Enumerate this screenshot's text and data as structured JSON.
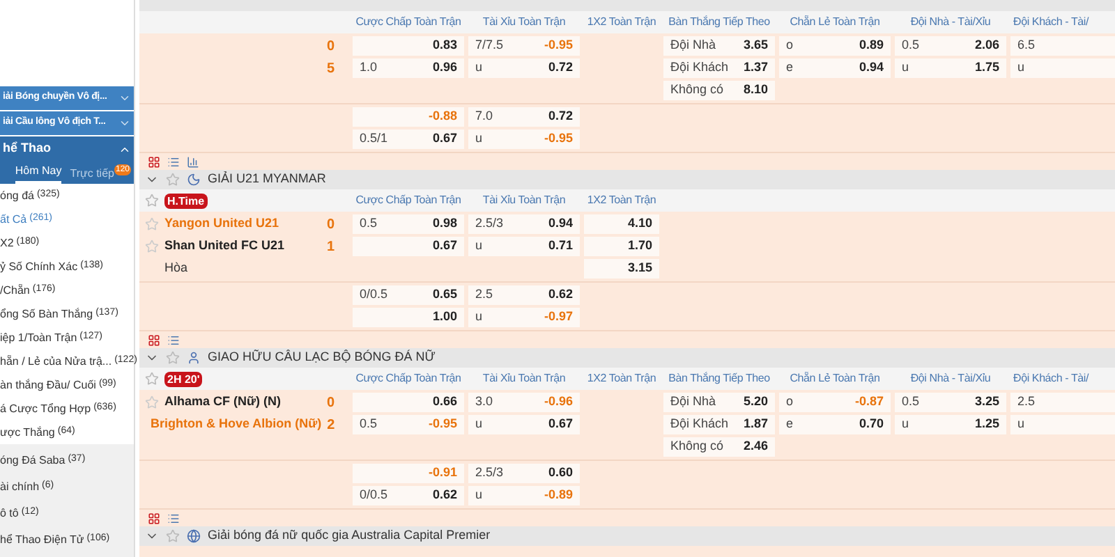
{
  "sidebar": {
    "leagues": [
      {
        "name": "iải Bóng chuyền Vô đị...",
        "expanded": false
      },
      {
        "name": "iải Cầu lông Vô địch T...",
        "expanded": false
      }
    ],
    "section": {
      "title": "hể Thao",
      "expanded": true
    },
    "tabs": [
      {
        "label": "Hôm Nay",
        "selected": true
      },
      {
        "label": "Trực tiếp",
        "selected": false,
        "badge": "120"
      }
    ],
    "markets": [
      {
        "name": "óng đá",
        "count": "(325)",
        "selected": false
      },
      {
        "name": "ất Cả",
        "count": "(261)",
        "selected": true
      },
      {
        "name": "X2",
        "count": "(180)",
        "selected": false
      },
      {
        "name": "ỷ Số Chính Xác",
        "count": "(138)",
        "selected": false
      },
      {
        "name": "/Chẵn",
        "count": "(176)",
        "selected": false
      },
      {
        "name": "ổng Số Bàn Thắng",
        "count": "(137)",
        "selected": false
      },
      {
        "name": "iệp 1/Toàn Trận",
        "count": "(127)",
        "selected": false
      },
      {
        "name": "hẵn / Lẻ của Nửa trậ...",
        "count": "(122)",
        "selected": false
      },
      {
        "name": "àn thắng Đầu/ Cuối",
        "count": "(99)",
        "selected": false
      },
      {
        "name": "á Cược Tổng Hợp",
        "count": "(636)",
        "selected": false
      },
      {
        "name": "ược Thắng",
        "count": "(64)",
        "selected": false
      }
    ],
    "sports": [
      {
        "name": "óng Đá Saba",
        "count": "(37)"
      },
      {
        "name": "ài chính",
        "count": "(6)"
      },
      {
        "name": "ô tô",
        "count": "(12)"
      },
      {
        "name": "hể Thao Điện Tử",
        "count": "(106)"
      }
    ]
  },
  "matches": [
    {
      "columns": [
        "Cược Chấp Toàn Trận",
        "Tài Xỉu Toàn Trận",
        "1X2 Toàn Trận",
        "Bàn Thắng Tiếp Theo",
        "Chẵn Lẻ Toàn Trận",
        "Đội Nhà - Tài/Xỉu",
        "Đội Khách - Tài/"
      ],
      "teams": [
        {
          "score": "0"
        },
        {
          "score": "5"
        }
      ],
      "groups": [
        {
          "rows": [
            [
              {
                "odds": "0.83",
                "negative": false
              },
              {
                "line": "7/7.5",
                "odds": "-0.95",
                "negative": true
              },
              null,
              {
                "line": "Đội Nhà",
                "odds": "3.65",
                "negative": false
              },
              {
                "line": "o",
                "odds": "0.89",
                "negative": false
              },
              {
                "line": "0.5",
                "odds": "2.06",
                "negative": false
              },
              {
                "line": "6.5"
              }
            ],
            [
              {
                "line": "1.0",
                "odds": "0.96",
                "negative": false
              },
              {
                "line": "u",
                "odds": "0.72",
                "negative": false
              },
              null,
              {
                "line": "Đội Khách",
                "odds": "1.37",
                "negative": false
              },
              {
                "line": "e",
                "odds": "0.94",
                "negative": false
              },
              {
                "line": "u",
                "odds": "1.75",
                "negative": false
              },
              {
                "line": "u"
              }
            ],
            [
              null,
              null,
              null,
              {
                "line": "Không có",
                "odds": "8.10",
                "negative": false
              }
            ]
          ]
        },
        {
          "rows": [
            [
              {
                "odds": "-0.88",
                "negative": true
              },
              {
                "line": "7.0",
                "odds": "0.72",
                "negative": false
              }
            ],
            [
              {
                "line": "0.5/1",
                "odds": "0.67",
                "negative": false
              },
              {
                "line": "u",
                "odds": "-0.95",
                "negative": true
              }
            ]
          ]
        }
      ]
    },
    {
      "league": {
        "name": "GIẢI U21 MYANMAR"
      },
      "badge": "H.Time",
      "columns": [
        "Cược Chấp Toàn Trận",
        "Tài Xỉu Toàn Trận",
        "1X2 Toàn Trận"
      ],
      "teams": [
        {
          "name": "Yangon United U21",
          "score": "0",
          "favorite": true
        },
        {
          "name": "Shan United FC U21",
          "score": "1",
          "favorite": false
        }
      ],
      "draw": "Hòa",
      "groups": [
        {
          "rows": [
            [
              {
                "line": "0.5",
                "odds": "0.98",
                "negative": false
              },
              {
                "line": "2.5/3",
                "odds": "0.94",
                "negative": false
              },
              {
                "odds": "4.10",
                "negative": false
              }
            ],
            [
              {
                "odds": "0.67",
                "negative": false
              },
              {
                "line": "u",
                "odds": "0.71",
                "negative": false
              },
              {
                "odds": "1.70",
                "negative": false
              }
            ],
            [
              null,
              null,
              {
                "odds": "3.15",
                "negative": false
              }
            ]
          ]
        },
        {
          "rows": [
            [
              {
                "line": "0/0.5",
                "odds": "0.65",
                "negative": false
              },
              {
                "line": "2.5",
                "odds": "0.62",
                "negative": false
              }
            ],
            [
              {
                "odds": "1.00",
                "negative": false
              },
              {
                "line": "u",
                "odds": "-0.97",
                "negative": true
              }
            ]
          ]
        }
      ]
    },
    {
      "league": {
        "name": "GIAO HỮU CÂU LẠC BỘ BÓNG ĐÁ NỮ"
      },
      "badge": "2H 20'",
      "columns": [
        "Cược Chấp Toàn Trận",
        "Tài Xỉu Toàn Trận",
        "1X2 Toàn Trận",
        "Bàn Thắng Tiếp Theo",
        "Chẵn Lẻ Toàn Trận",
        "Đội Nhà - Tài/Xỉu",
        "Đội Khách - Tài/"
      ],
      "teams": [
        {
          "name": "Alhama CF (Nữ) (N)",
          "score": "0",
          "favorite": false
        },
        {
          "name": "Brighton & Hove Albion (Nữ)",
          "score": "2",
          "favorite": true
        }
      ],
      "groups": [
        {
          "rows": [
            [
              {
                "odds": "0.66",
                "negative": false
              },
              {
                "line": "3.0",
                "odds": "-0.96",
                "negative": true
              },
              null,
              {
                "line": "Đội Nhà",
                "odds": "5.20",
                "negative": false
              },
              {
                "line": "o",
                "odds": "-0.87",
                "negative": true
              },
              {
                "line": "0.5",
                "odds": "3.25",
                "negative": false
              },
              {
                "line": "2.5"
              }
            ],
            [
              {
                "line": "0.5",
                "odds": "-0.95",
                "negative": true
              },
              {
                "line": "u",
                "odds": "0.67",
                "negative": false
              },
              null,
              {
                "line": "Đội Khách",
                "odds": "1.87",
                "negative": false
              },
              {
                "line": "e",
                "odds": "0.70",
                "negative": false
              },
              {
                "line": "u",
                "odds": "1.25",
                "negative": false
              },
              {
                "line": "u"
              }
            ],
            [
              null,
              null,
              null,
              {
                "line": "Không có",
                "odds": "2.46",
                "negative": false
              }
            ]
          ]
        },
        {
          "rows": [
            [
              {
                "odds": "-0.91",
                "negative": true
              },
              {
                "line": "2.5/3",
                "odds": "0.60",
                "negative": false
              }
            ],
            [
              {
                "line": "0/0.5",
                "odds": "0.62",
                "negative": false
              },
              {
                "line": "u",
                "odds": "-0.89",
                "negative": true
              }
            ]
          ]
        }
      ]
    },
    {
      "league": {
        "name": "Giải bóng đá nữ quốc gia Australia Capital Premier"
      }
    }
  ]
}
